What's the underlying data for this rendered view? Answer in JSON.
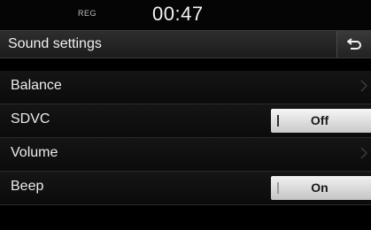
{
  "status": {
    "indicator": "REG",
    "time": "00:47"
  },
  "header": {
    "title": "Sound settings",
    "back_icon": "back-arrow-icon"
  },
  "list": {
    "items": [
      {
        "label": "Balance",
        "control": "chevron",
        "icon": "chevron-right-icon"
      },
      {
        "label": "SDVC",
        "control": "toggle",
        "value": "Off"
      },
      {
        "label": "Volume",
        "control": "chevron",
        "icon": "chevron-right-icon"
      },
      {
        "label": "Beep",
        "control": "toggle",
        "value": "On"
      }
    ]
  },
  "colors": {
    "background": "#000000",
    "text": "#ececec",
    "toggle": "#e6e6e6"
  }
}
